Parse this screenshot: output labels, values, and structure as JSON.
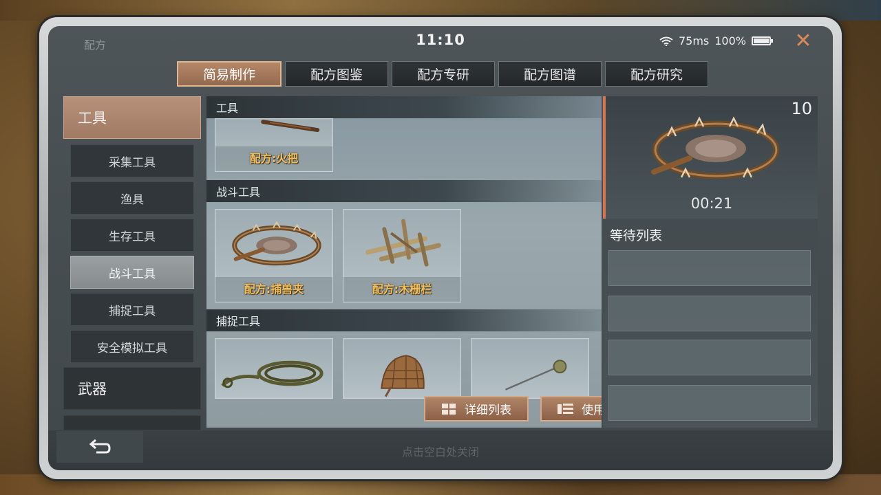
{
  "window": {
    "title": "配方",
    "clock": "11:10",
    "ping": "75ms",
    "battery": "100%",
    "battery_level": 1.0,
    "close_label": "✕"
  },
  "tabs": [
    {
      "label": "简易制作",
      "active": true
    },
    {
      "label": "配方图鉴",
      "active": false
    },
    {
      "label": "配方专研",
      "active": false
    },
    {
      "label": "配方图谱",
      "active": false
    },
    {
      "label": "配方研究",
      "active": false
    }
  ],
  "sidebar": {
    "category_tools": "工具",
    "subcategories": [
      {
        "label": "采集工具",
        "active": false
      },
      {
        "label": "渔具",
        "active": false
      },
      {
        "label": "生存工具",
        "active": false
      },
      {
        "label": "战斗工具",
        "active": true
      },
      {
        "label": "捕捉工具",
        "active": false
      },
      {
        "label": "安全模拟工具",
        "active": false
      }
    ],
    "category_weapons": "武器"
  },
  "content": {
    "section_tools": "工具",
    "torch_card": "配方:火把",
    "section_combat": "战斗工具",
    "combat_cards": [
      {
        "label": "配方:捕兽夹",
        "icon": "bear-trap-icon"
      },
      {
        "label": "配方:木栅栏",
        "icon": "wooden-fence-icon"
      }
    ],
    "section_capture": "捕捉工具",
    "capture_cards": [
      {
        "icon": "rope-lasso-icon"
      },
      {
        "icon": "wicker-basket-icon"
      },
      {
        "icon": "net-stick-icon"
      }
    ]
  },
  "actions": {
    "detail_list": "详细列表",
    "use_materials": "使用材料"
  },
  "crafting": {
    "count": "10",
    "timer": "00:21",
    "queue_title": "等待列表"
  },
  "footer": {
    "close_hint": "点击空白处关闭"
  },
  "colors": {
    "accent": "#d7744a",
    "active_tab": "#a67c5e",
    "recipe_label": "#f0c060"
  }
}
